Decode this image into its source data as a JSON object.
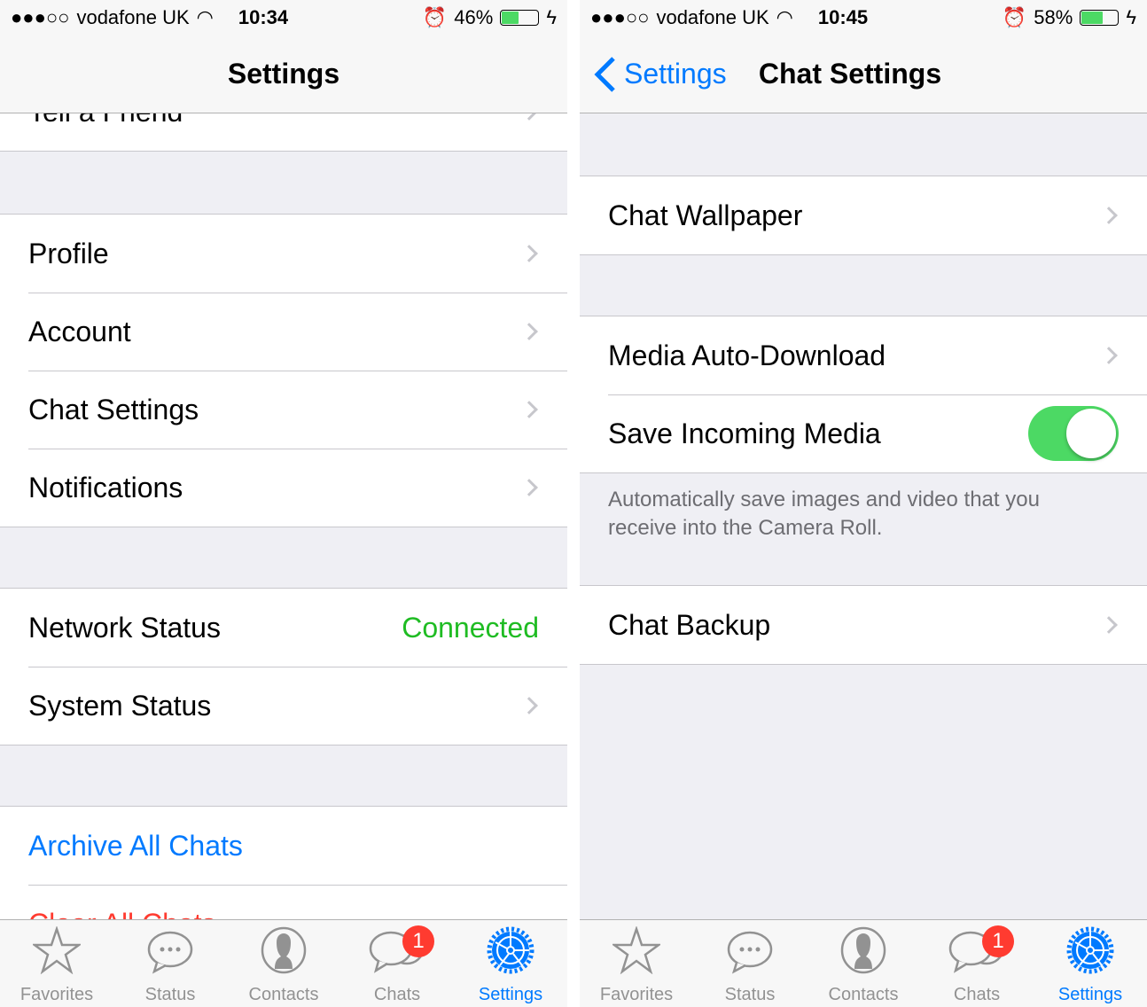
{
  "colors": {
    "accent": "#007aff",
    "connected": "#1fbc23",
    "destructive": "#ff3b30",
    "toggle_on": "#4cd964"
  },
  "left": {
    "status": {
      "signal": "●●●○○",
      "carrier": "vodafone UK",
      "time": "10:34",
      "battery": "46%",
      "battery_level": 46
    },
    "title": "Settings",
    "tell_friend": "Tell a Friend",
    "group1": [
      "Profile",
      "Account",
      "Chat Settings",
      "Notifications"
    ],
    "network": {
      "label": "Network Status",
      "value": "Connected"
    },
    "system": "System Status",
    "archive": "Archive All Chats",
    "clear": "Clear All Chats"
  },
  "right": {
    "status": {
      "signal": "●●●○○",
      "carrier": "vodafone UK",
      "time": "10:45",
      "battery": "58%",
      "battery_level": 58
    },
    "back": "Settings",
    "title": "Chat Settings",
    "wallpaper": "Chat Wallpaper",
    "media": "Media Auto-Download",
    "save": {
      "label": "Save Incoming Media",
      "on": true
    },
    "footer": "Automatically save images and video that you receive into the Camera Roll.",
    "backup": "Chat Backup"
  },
  "tabs": [
    {
      "label": "Favorites",
      "icon": "star-icon"
    },
    {
      "label": "Status",
      "icon": "speech-bubble-icon"
    },
    {
      "label": "Contacts",
      "icon": "person-icon"
    },
    {
      "label": "Chats",
      "icon": "chats-icon",
      "badge": "1"
    },
    {
      "label": "Settings",
      "icon": "gear-icon",
      "active": true
    }
  ]
}
